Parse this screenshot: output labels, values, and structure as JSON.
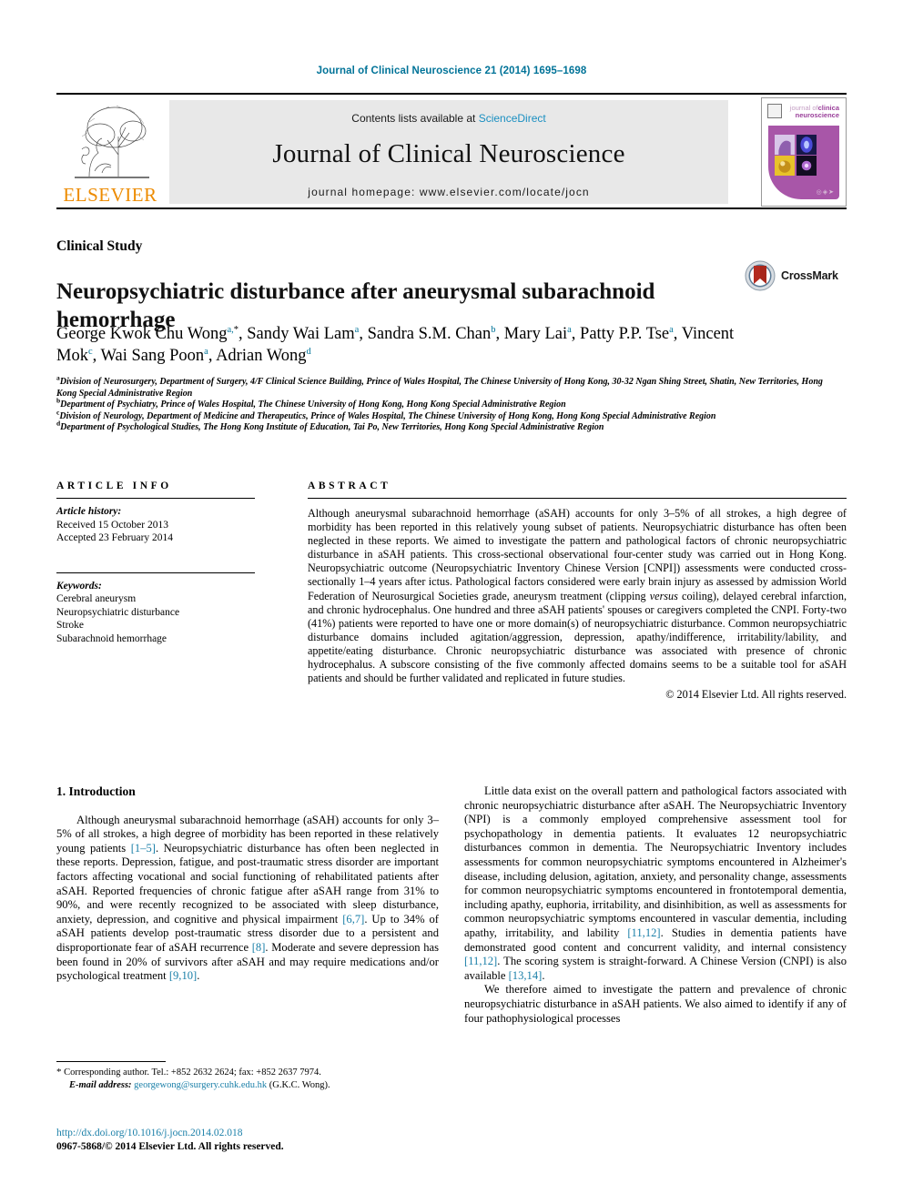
{
  "running_head": "Journal of Clinical Neuroscience 21 (2014) 1695–1698",
  "masthead": {
    "publisher_word": "ELSEVIER",
    "contents_prefix": "Contents lists available at ",
    "contents_link": "ScienceDirect",
    "journal_name": "Journal of Clinical Neuroscience",
    "homepage": "journal homepage: www.elsevier.com/locate/jocn",
    "cover": {
      "title_small": "journal of",
      "title_line1": "clinica",
      "title_line2": "neuroscience",
      "dots": "◎◈➤"
    }
  },
  "article": {
    "section_label": "Clinical Study",
    "title": "Neuropsychiatric disturbance after aneurysmal subarachnoid hemorrhage",
    "crossmark_label": "CrossMark"
  },
  "authors_html": "George Kwok Chu Wong<sup>a,</sup><sup class=\"star\">*</sup>, Sandy Wai Lam<sup>a</sup>, Sandra S.M. Chan<sup>b</sup>, Mary Lai<sup>a</sup>, Patty P.P. Tse<sup>a</sup>, Vincent Mok<sup>c</sup>, Wai Sang Poon<sup>a</sup>, Adrian Wong<sup>d</sup>",
  "affiliations": [
    {
      "mark": "a",
      "text": "Division of Neurosurgery, Department of Surgery, 4/F Clinical Science Building, Prince of Wales Hospital, The Chinese University of Hong Kong, 30-32 Ngan Shing Street, Shatin, New Territories, Hong Kong Special Administrative Region"
    },
    {
      "mark": "b",
      "text": "Department of Psychiatry, Prince of Wales Hospital, The Chinese University of Hong Kong, Hong Kong Special Administrative Region"
    },
    {
      "mark": "c",
      "text": "Division of Neurology, Department of Medicine and Therapeutics, Prince of Wales Hospital, The Chinese University of Hong Kong, Hong Kong Special Administrative Region"
    },
    {
      "mark": "d",
      "text": "Department of Psychological Studies, The Hong Kong Institute of Education, Tai Po, New Territories, Hong Kong Special Administrative Region"
    }
  ],
  "article_info": {
    "heading": "ARTICLE INFO",
    "history_label": "Article history:",
    "received": "Received 15 October 2013",
    "accepted": "Accepted 23 February 2014",
    "keywords_label": "Keywords:",
    "keywords": [
      "Cerebral aneurysm",
      "Neuropsychiatric disturbance",
      "Stroke",
      "Subarachnoid hemorrhage"
    ]
  },
  "abstract": {
    "heading": "ABSTRACT",
    "text_html": "Although aneurysmal subarachnoid hemorrhage (aSAH) accounts for only 3–5% of all strokes, a high degree of morbidity has been reported in this relatively young subset of patients. Neuropsychiatric disturbance has often been neglected in these reports. We aimed to investigate the pattern and pathological factors of chronic neuropsychiatric disturbance in aSAH patients. This cross-sectional observational four-center study was carried out in Hong Kong. Neuropsychiatric outcome (Neuropsychiatric Inventory Chinese Version [CNPI]) assessments were conducted cross-sectionally 1–4 years after ictus. Pathological factors considered were early brain injury as assessed by admission World Federation of Neurosurgical Societies grade, aneurysm treatment (clipping <em>versus</em> coiling), delayed cerebral infarction, and chronic hydrocephalus. One hundred and three aSAH patients' spouses or caregivers completed the CNPI. Forty-two (41%) patients were reported to have one or more domain(s) of neuropsychiatric disturbance. Common neuropsychiatric disturbance domains included agitation/aggression, depression, apathy/indifference, irritability/lability, and appetite/eating disturbance. Chronic neuropsychiatric disturbance was associated with presence of chronic hydrocephalus. A subscore consisting of the five commonly affected domains seems to be a suitable tool for aSAH patients and should be further validated and replicated in future studies.",
    "copyright": "© 2014 Elsevier Ltd. All rights reserved."
  },
  "introduction": {
    "heading": "1. Introduction",
    "left_paragraphs_html": [
      "Although aneurysmal subarachnoid hemorrhage (aSAH) accounts for only 3–5% of all strokes, a high degree of morbidity has been reported in these relatively young patients <span class=\"ref\">[1–5]</span>. Neuropsychiatric disturbance has often been neglected in these reports. Depression, fatigue, and post-traumatic stress disorder are important factors affecting vocational and social functioning of rehabilitated patients after aSAH. Reported frequencies of chronic fatigue after aSAH range from 31% to 90%, and were recently recognized to be associated with sleep disturbance, anxiety, depression, and cognitive and physical impairment <span class=\"ref\">[6,7]</span>. Up to 34% of aSAH patients develop post-traumatic stress disorder due to a persistent and disproportionate fear of aSAH recurrence <span class=\"ref\">[8]</span>. Moderate and severe depression has been found in 20% of survivors after aSAH and may require medications and/or psychological treatment <span class=\"ref\">[9,10]</span>."
    ],
    "right_paragraphs_html": [
      "Little data exist on the overall pattern and pathological factors associated with chronic neuropsychiatric disturbance after aSAH. The Neuropsychiatric Inventory (NPI) is a commonly employed comprehensive assessment tool for psychopathology in dementia patients. It evaluates 12 neuropsychiatric disturbances common in dementia. The Neuropsychiatric Inventory includes assessments for common neuropsychiatric symptoms encountered in Alzheimer's disease, including delusion, agitation, anxiety, and personality change, assessments for common neuropsychiatric symptoms encountered in frontotemporal dementia, including apathy, euphoria, irritability, and disinhibition, as well as assessments for common neuropsychiatric symptoms encountered in vascular dementia, including apathy, irritability, and lability <span class=\"ref\">[11,12]</span>. Studies in dementia patients have demonstrated good content and concurrent validity, and internal consistency <span class=\"ref\">[11,12]</span>. The scoring system is straight-forward. A Chinese Version (CNPI) is also available <span class=\"ref\">[13,14]</span>.",
      "We therefore aimed to investigate the pattern and prevalence of chronic neuropsychiatric disturbance in aSAH patients. We also aimed to identify if any of four pathophysiological processes"
    ]
  },
  "footnote": {
    "star": "*",
    "corresponding": "Corresponding author. Tel.: +852 2632 2624; fax: +852 2637 7974.",
    "email_label": "E-mail address:",
    "email": "georgewong@surgery.cuhk.edu.hk",
    "email_suffix": "(G.K.C. Wong)."
  },
  "footer": {
    "doi": "http://dx.doi.org/10.1016/j.jocn.2014.02.018",
    "issn_rights": "0967-5868/© 2014 Elsevier Ltd. All rights reserved."
  },
  "colors": {
    "link": "#1a7fa8",
    "running_head": "#007398",
    "elsevier_orange": "#ed8b00",
    "cover_purple": "#a856a8",
    "band_gray": "#e8e8e8"
  }
}
